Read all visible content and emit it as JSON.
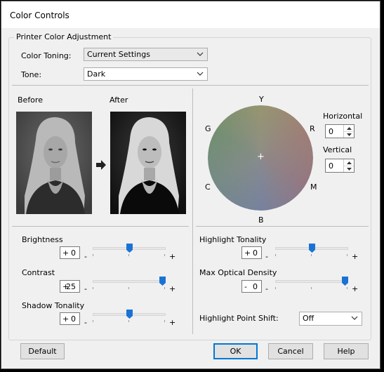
{
  "window": {
    "title": "Color Controls"
  },
  "group": {
    "title": "Printer Color Adjustment"
  },
  "color_toning": {
    "label": "Color Toning:",
    "value": "Current Settings"
  },
  "tone": {
    "label": "Tone:",
    "value": "Dark"
  },
  "preview": {
    "before_label": "Before",
    "after_label": "After"
  },
  "color_wheel": {
    "labels": {
      "y": "Y",
      "r": "R",
      "m": "M",
      "b": "B",
      "c": "C",
      "g": "G"
    },
    "center": "+"
  },
  "horizontal": {
    "label": "Horizontal",
    "value": "0"
  },
  "vertical": {
    "label": "Vertical",
    "value": "0"
  },
  "sliders": {
    "brightness": {
      "label": "Brightness",
      "sign": "+",
      "value": "0",
      "level": 0.5
    },
    "contrast": {
      "label": "Contrast",
      "sign": "+",
      "value": "25",
      "level": 1.0
    },
    "shadow_tonality": {
      "label": "Shadow Tonality",
      "sign": "+",
      "value": "0",
      "level": 0.5
    },
    "highlight_tonality": {
      "label": "Highlight Tonality",
      "sign": "+",
      "value": "0",
      "level": 0.5
    },
    "max_optical_density": {
      "label": "Max Optical Density",
      "sign": "-",
      "value": "0",
      "level": 1.0
    },
    "minus": "-",
    "plus": "+"
  },
  "highlight_point_shift": {
    "label": "Highlight Point Shift:",
    "value": "Off"
  },
  "buttons": {
    "default": "Default",
    "ok": "OK",
    "cancel": "Cancel",
    "help": "Help"
  },
  "colors": {
    "accent": "#0078d7",
    "slider_thumb": "#1a73d4"
  }
}
